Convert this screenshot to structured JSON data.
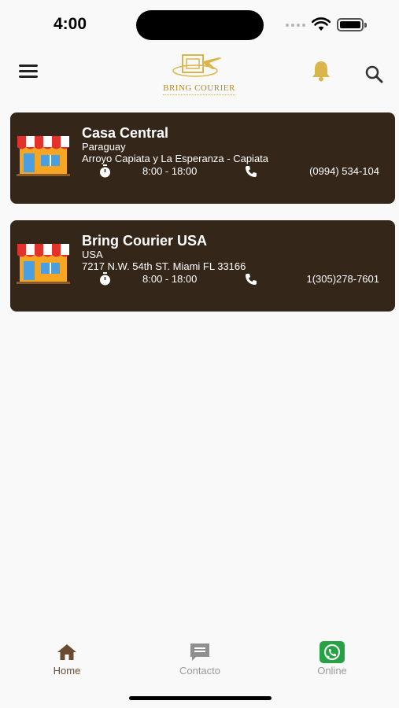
{
  "status_bar": {
    "time": "4:00"
  },
  "header": {
    "logo_text": "BRING COURIER",
    "icons": [
      "menu-icon",
      "bell-icon",
      "search-icon"
    ]
  },
  "colors": {
    "card_bg": "#35261a",
    "accent_gold": "#d9b54a",
    "home_active": "#6b4a32",
    "whatsapp_green": "#25a244"
  },
  "branches": [
    {
      "name": "Casa Central",
      "country": "Paraguay",
      "address": "Arroyo Capiata y La Esperanza - Capiata",
      "hours": "8:00 - 18:00",
      "phone": "(0994) 534-104"
    },
    {
      "name": "Bring Courier USA",
      "country": "USA",
      "address": "7217 N.W. 54th ST. Miami FL 33166",
      "hours": "8:00 - 18:00",
      "phone": "1(305)278-7601"
    }
  ],
  "tabs": [
    {
      "label": "Home",
      "icon": "home-icon",
      "active": true
    },
    {
      "label": "Contacto",
      "icon": "chat-icon",
      "active": false
    },
    {
      "label": "Online",
      "icon": "whatsapp-icon",
      "active": false
    }
  ]
}
